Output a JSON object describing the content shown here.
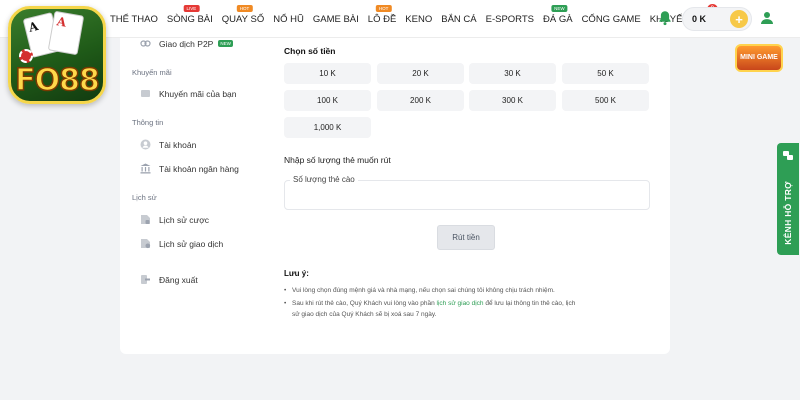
{
  "logo": {
    "text": "FO88",
    "card1": "A",
    "card2": "A"
  },
  "nav": {
    "items": [
      {
        "label": "THỂ THAO",
        "badge": ""
      },
      {
        "label": "SÒNG BÀI",
        "badge": "LIVE"
      },
      {
        "label": "QUAY SỐ",
        "badge": "HOT"
      },
      {
        "label": "NỔ HŨ",
        "badge": ""
      },
      {
        "label": "GAME BÀI",
        "badge": ""
      },
      {
        "label": "LÔ ĐỀ",
        "badge": "HOT"
      },
      {
        "label": "KENO",
        "badge": ""
      },
      {
        "label": "BẮN CÁ",
        "badge": ""
      },
      {
        "label": "E-SPORTS",
        "badge": ""
      },
      {
        "label": "ĐÁ GÀ",
        "badge": "NEW"
      },
      {
        "label": "CỔNG GAME",
        "badge": ""
      },
      {
        "label": "KHUYẾN MÃI",
        "badge": ""
      }
    ],
    "promo_count": "9"
  },
  "header": {
    "balance": "0 K",
    "plus": "+"
  },
  "mini_game": {
    "label": "MINI GAME"
  },
  "support": {
    "label": "KÊNH HỖ TRỢ"
  },
  "sidebar": {
    "p2p": {
      "label": "Giao dịch P2P",
      "tag": "NEW"
    },
    "sections": {
      "promo": "Khuyến mãi",
      "info": "Thông tin",
      "history": "Lịch sử"
    },
    "items": {
      "my_promo": "Khuyến mãi của bạn",
      "account": "Tài khoản",
      "bank_account": "Tài khoản ngân hàng",
      "bet_history": "Lịch sử cược",
      "transaction_history": "Lịch sử giao dịch",
      "logout": "Đăng xuất"
    }
  },
  "main": {
    "choose_amount_label": "Chọn số tiền",
    "amounts": [
      "10 K",
      "20 K",
      "30 K",
      "50 K",
      "100 K",
      "200 K",
      "300 K",
      "500 K",
      "1,000 K"
    ],
    "quantity_label": "Nhập số lượng thẻ muốn rút",
    "quantity_field_label": "Số lượng thẻ cào",
    "quantity_value": "",
    "withdraw_button": "Rút tiền",
    "note_title": "Lưu ý:",
    "note_1": "Vui lòng chọn đúng mệnh giá và nhà mạng, nếu chọn sai chúng tôi không chịu trách nhiệm.",
    "note_2_before": "Sau khi rút thẻ cào, Quý Khách vui lòng vào phần ",
    "note_2_link": "lịch sử giao dịch",
    "note_2_after": " để lưu lại thông tin thẻ cào, lịch",
    "note_2_line2": "sử giao dịch của Quý Khách sẽ bị xoá sau 7 ngày."
  },
  "colors": {
    "accent": "#2e9e55",
    "hot": "#f08a24",
    "live": "#e53935",
    "coin": "#f7c948"
  }
}
